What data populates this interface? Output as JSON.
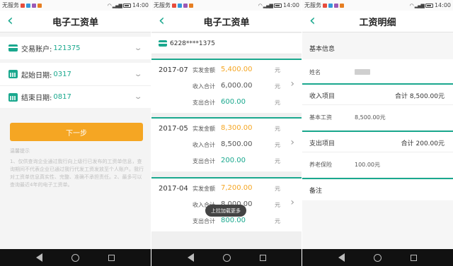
{
  "status": {
    "carrier": "无服务",
    "time": "14:00"
  },
  "screen1": {
    "title": "电子工资单",
    "account_label": "交易账户:",
    "account_value": "121375",
    "start_label": "起始日期:",
    "start_value": "0317",
    "end_label": "结束日期:",
    "end_value": "0817",
    "next_button": "下一步",
    "tips_title": "温馨提示",
    "tips_text": "1、仅供查询企业通过我行向上级行已发布的工资单信息，查询期间不代表企业已通过我行代发工资发放至个人账户。我行对工资单信息真实性、完整、准确不承担责任。2、最多可以查询最近4年的电子工资单。"
  },
  "screen2": {
    "title": "电子工资单",
    "account": "6228****1375",
    "actual_label": "实发金额",
    "income_label": "收入合计",
    "expense_label": "支出合计",
    "unit": "元",
    "records": [
      {
        "month": "2017-07",
        "actual": "5,400.00",
        "income": "6,000.00",
        "expense": "600.00"
      },
      {
        "month": "2017-05",
        "actual": "8,300.00",
        "income": "8,500.00",
        "expense": "200.00"
      },
      {
        "month": "2017-04",
        "actual": "7,200.00",
        "income": "8,000.00",
        "expense": "800.00"
      }
    ],
    "toast": "上拉加载更多"
  },
  "screen3": {
    "title": "工资明细",
    "basic_info": "基本信息",
    "name_label": "姓名",
    "income_section": "收入项目",
    "income_total": "合计 8,500.00元",
    "base_salary_label": "基本工资",
    "base_salary_value": "8,500.00元",
    "expense_section": "支出项目",
    "expense_total": "合计 200.00元",
    "pension_label": "养老保险",
    "pension_value": "100.00元",
    "notes": "备注"
  },
  "colors": {
    "accent": "#1aa88e",
    "orange": "#f5a623"
  }
}
